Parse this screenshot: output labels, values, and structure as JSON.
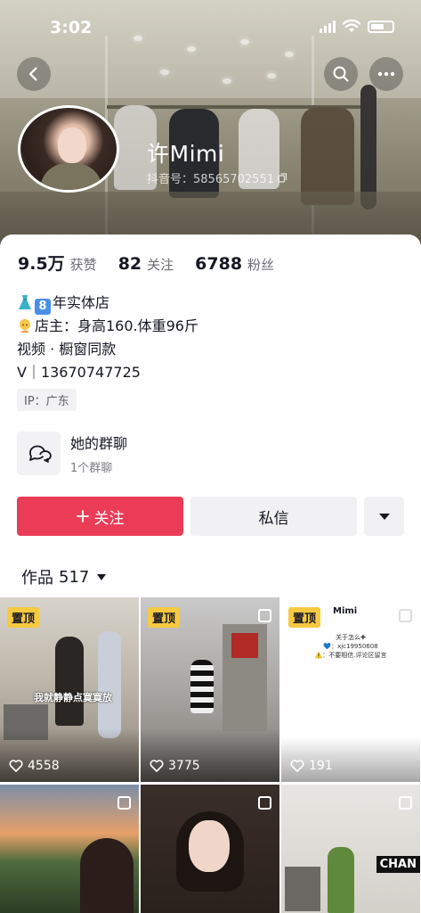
{
  "status_bar": {
    "time": "3:02"
  },
  "profile": {
    "name": "许Mimi",
    "douyin_id": "抖音号：58565702551"
  },
  "stats": [
    {
      "value": "9.5万",
      "label": "获赞"
    },
    {
      "value": "82",
      "label": "关注"
    },
    {
      "value": "6788",
      "label": "粉丝"
    }
  ],
  "bio": {
    "line1": "年实体店",
    "line1_number": "8",
    "line2": "店主：身高160.体重96斤",
    "line3": "视频 · 橱窗同款",
    "line4": "V｜13670747725"
  },
  "ip_tag": "IP：广东",
  "group_chat": {
    "title": "她的群聊",
    "subtitle": "1个群聊"
  },
  "actions": {
    "follow_label": "关注",
    "message_label": "私信"
  },
  "works_tab": {
    "label": "作品",
    "count": "517"
  },
  "videos": [
    {
      "pinned_label": "置顶",
      "likes": "4558",
      "caption": "我就静静点寞寞放"
    },
    {
      "pinned_label": "置顶",
      "likes": "3775"
    },
    {
      "pinned_label": "置顶",
      "likes": "191",
      "note_title": "Mimi",
      "note_lines": [
        "关于怎么✚",
        "💙：xjc19950608",
        "⚠️：不要相信.评论区留言"
      ]
    },
    {},
    {},
    {
      "sign_text": "CHAN"
    }
  ],
  "colors": {
    "accent": "#ea3c56",
    "pin": "#f6c940"
  }
}
